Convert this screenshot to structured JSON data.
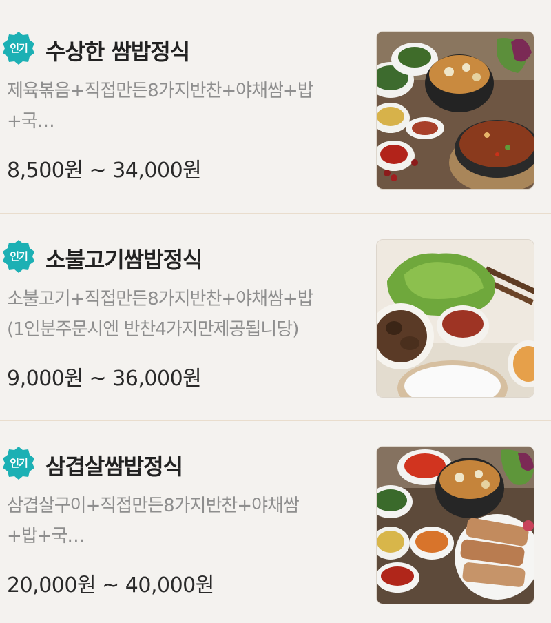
{
  "badge_color": "#1cb0b4",
  "items": [
    {
      "badge": "인기",
      "title": "수상한 쌈밥정식",
      "desc_line1": "제육볶음+직접만든8가지반찬+야채쌈+밥",
      "desc_line2": "+국…",
      "price": "8,500원 ~ 34,000원",
      "image": "jeyuk-ssambap-photo"
    },
    {
      "badge": "인기",
      "title": "소불고기쌈밥정식",
      "desc_line1": "소불고기+직접만든8가지반찬+야채쌈+밥",
      "desc_line2": "(1인분주문시엔 반찬4가지만제공됩니당)",
      "price": "9,000원 ~ 36,000원",
      "image": "bulgogi-ssambap-photo"
    },
    {
      "badge": "인기",
      "title": "삼겹살쌈밥정식",
      "desc_line1": "삼겹살구이+직접만든8가지반찬+야채쌈",
      "desc_line2": "+밥+국…",
      "price": "20,000원 ~ 40,000원",
      "image": "samgyeopsal-ssambap-photo"
    }
  ]
}
